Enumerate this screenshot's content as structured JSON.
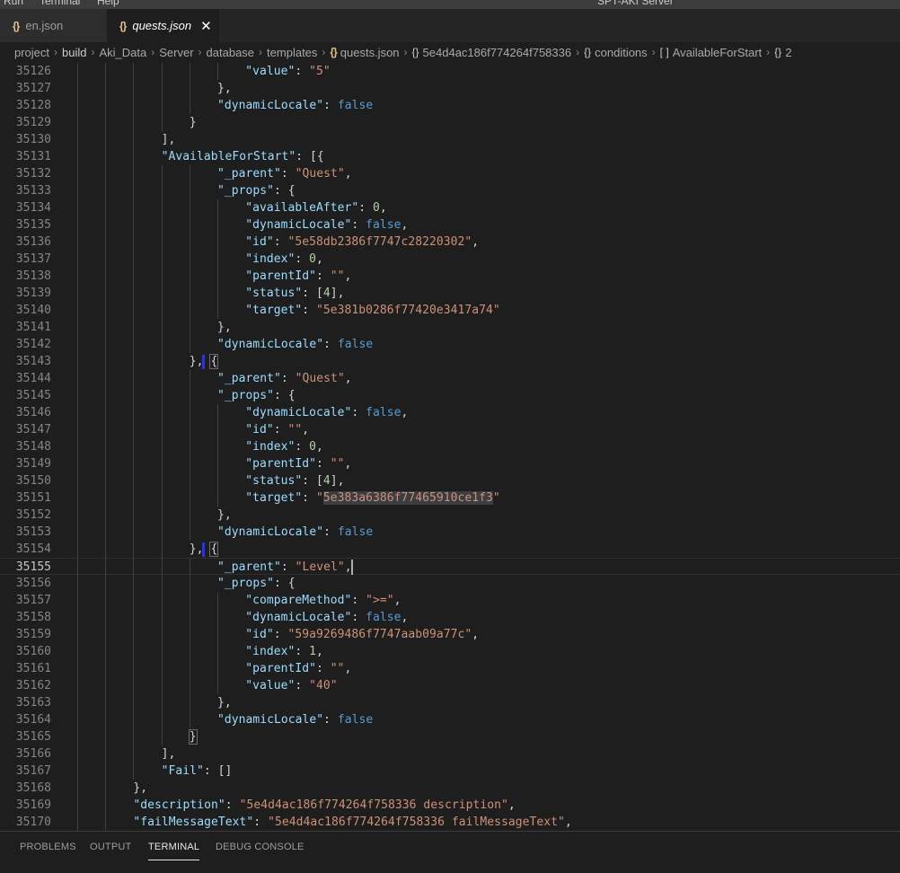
{
  "menubar": {
    "items": [
      "Run",
      "Terminal",
      "Help"
    ],
    "window_title": "SPT-AKI Server"
  },
  "tabs": [
    {
      "label": "en.json",
      "active": false
    },
    {
      "label": "quests.json",
      "active": true
    }
  ],
  "breadcrumb": [
    "project",
    "build",
    "Aki_Data",
    "Server",
    "database",
    "templates",
    "quests.json",
    "5e4d4ac186f774264f758336",
    "conditions",
    "AvailableForStart",
    "2"
  ],
  "editor": {
    "current_line": 35155,
    "lines": [
      {
        "n": 35126,
        "indent": 6,
        "tokens": [
          [
            "k",
            "\"value\""
          ],
          [
            "p",
            ": "
          ],
          [
            "s",
            "\"5\""
          ]
        ]
      },
      {
        "n": 35127,
        "indent": 5,
        "tokens": [
          [
            "p",
            "},"
          ]
        ]
      },
      {
        "n": 35128,
        "indent": 5,
        "tokens": [
          [
            "k",
            "\"dynamicLocale\""
          ],
          [
            "p",
            ": "
          ],
          [
            "b",
            "false"
          ]
        ]
      },
      {
        "n": 35129,
        "indent": 4,
        "tokens": [
          [
            "p",
            "}"
          ]
        ]
      },
      {
        "n": 35130,
        "indent": 3,
        "tokens": [
          [
            "p",
            "],"
          ]
        ]
      },
      {
        "n": 35131,
        "indent": 3,
        "tokens": [
          [
            "k",
            "\"AvailableForStart\""
          ],
          [
            "p",
            ": [{"
          ]
        ]
      },
      {
        "n": 35132,
        "indent": 5,
        "tokens": [
          [
            "k",
            "\"_parent\""
          ],
          [
            "p",
            ": "
          ],
          [
            "s",
            "\"Quest\""
          ],
          [
            "p",
            ","
          ]
        ]
      },
      {
        "n": 35133,
        "indent": 5,
        "tokens": [
          [
            "k",
            "\"_props\""
          ],
          [
            "p",
            ": {"
          ]
        ]
      },
      {
        "n": 35134,
        "indent": 6,
        "tokens": [
          [
            "k",
            "\"availableAfter\""
          ],
          [
            "p",
            ": "
          ],
          [
            "n",
            "0"
          ],
          [
            "p",
            ","
          ]
        ]
      },
      {
        "n": 35135,
        "indent": 6,
        "tokens": [
          [
            "k",
            "\"dynamicLocale\""
          ],
          [
            "p",
            ": "
          ],
          [
            "b",
            "false"
          ],
          [
            "p",
            ","
          ]
        ]
      },
      {
        "n": 35136,
        "indent": 6,
        "tokens": [
          [
            "k",
            "\"id\""
          ],
          [
            "p",
            ": "
          ],
          [
            "s",
            "\"5e58db2386f7747c28220302\""
          ],
          [
            "p",
            ","
          ]
        ]
      },
      {
        "n": 35137,
        "indent": 6,
        "tokens": [
          [
            "k",
            "\"index\""
          ],
          [
            "p",
            ": "
          ],
          [
            "n",
            "0"
          ],
          [
            "p",
            ","
          ]
        ]
      },
      {
        "n": 35138,
        "indent": 6,
        "tokens": [
          [
            "k",
            "\"parentId\""
          ],
          [
            "p",
            ": "
          ],
          [
            "s",
            "\"\""
          ],
          [
            "p",
            ","
          ]
        ]
      },
      {
        "n": 35139,
        "indent": 6,
        "tokens": [
          [
            "k",
            "\"status\""
          ],
          [
            "p",
            ": ["
          ],
          [
            "n",
            "4"
          ],
          [
            "p",
            "],"
          ]
        ]
      },
      {
        "n": 35140,
        "indent": 6,
        "tokens": [
          [
            "k",
            "\"target\""
          ],
          [
            "p",
            ": "
          ],
          [
            "s",
            "\"5e381b0286f77420e3417a74\""
          ]
        ]
      },
      {
        "n": 35141,
        "indent": 5,
        "tokens": [
          [
            "p",
            "},"
          ]
        ]
      },
      {
        "n": 35142,
        "indent": 5,
        "tokens": [
          [
            "k",
            "\"dynamicLocale\""
          ],
          [
            "p",
            ": "
          ],
          [
            "b",
            "false"
          ]
        ]
      },
      {
        "n": 35143,
        "indent": 4,
        "tokens": [
          [
            "p",
            "}, "
          ],
          [
            "brk",
            "{"
          ]
        ],
        "bluebar": true
      },
      {
        "n": 35144,
        "indent": 5,
        "tokens": [
          [
            "k",
            "\"_parent\""
          ],
          [
            "p",
            ": "
          ],
          [
            "s",
            "\"Quest\""
          ],
          [
            "p",
            ","
          ]
        ]
      },
      {
        "n": 35145,
        "indent": 5,
        "tokens": [
          [
            "k",
            "\"_props\""
          ],
          [
            "p",
            ": {"
          ]
        ]
      },
      {
        "n": 35146,
        "indent": 6,
        "tokens": [
          [
            "k",
            "\"dynamicLocale\""
          ],
          [
            "p",
            ": "
          ],
          [
            "b",
            "false"
          ],
          [
            "p",
            ","
          ]
        ]
      },
      {
        "n": 35147,
        "indent": 6,
        "tokens": [
          [
            "k",
            "\"id\""
          ],
          [
            "p",
            ": "
          ],
          [
            "s",
            "\"\""
          ],
          [
            "p",
            ","
          ]
        ]
      },
      {
        "n": 35148,
        "indent": 6,
        "tokens": [
          [
            "k",
            "\"index\""
          ],
          [
            "p",
            ": "
          ],
          [
            "n",
            "0"
          ],
          [
            "p",
            ","
          ]
        ]
      },
      {
        "n": 35149,
        "indent": 6,
        "tokens": [
          [
            "k",
            "\"parentId\""
          ],
          [
            "p",
            ": "
          ],
          [
            "s",
            "\"\""
          ],
          [
            "p",
            ","
          ]
        ]
      },
      {
        "n": 35150,
        "indent": 6,
        "tokens": [
          [
            "k",
            "\"status\""
          ],
          [
            "p",
            ": ["
          ],
          [
            "n",
            "4"
          ],
          [
            "p",
            "],"
          ]
        ]
      },
      {
        "n": 35151,
        "indent": 6,
        "tokens": [
          [
            "k",
            "\"target\""
          ],
          [
            "p",
            ": "
          ],
          [
            "s",
            "\""
          ],
          [
            "hl",
            "5e383a6386f77465910ce1f3"
          ],
          [
            "s",
            "\""
          ]
        ]
      },
      {
        "n": 35152,
        "indent": 5,
        "tokens": [
          [
            "p",
            "},"
          ]
        ]
      },
      {
        "n": 35153,
        "indent": 5,
        "tokens": [
          [
            "k",
            "\"dynamicLocale\""
          ],
          [
            "p",
            ": "
          ],
          [
            "b",
            "false"
          ]
        ]
      },
      {
        "n": 35154,
        "indent": 4,
        "tokens": [
          [
            "p",
            "}, "
          ],
          [
            "brk",
            "{"
          ]
        ],
        "bluebar": true
      },
      {
        "n": 35155,
        "indent": 5,
        "tokens": [
          [
            "k",
            "\"_parent\""
          ],
          [
            "p",
            ": "
          ],
          [
            "s",
            "\"Level\""
          ],
          [
            "p",
            ","
          ]
        ],
        "caret": true
      },
      {
        "n": 35156,
        "indent": 5,
        "tokens": [
          [
            "k",
            "\"_props\""
          ],
          [
            "p",
            ": {"
          ]
        ]
      },
      {
        "n": 35157,
        "indent": 6,
        "tokens": [
          [
            "k",
            "\"compareMethod\""
          ],
          [
            "p",
            ": "
          ],
          [
            "s",
            "\">=\""
          ],
          [
            "p",
            ","
          ]
        ]
      },
      {
        "n": 35158,
        "indent": 6,
        "tokens": [
          [
            "k",
            "\"dynamicLocale\""
          ],
          [
            "p",
            ": "
          ],
          [
            "b",
            "false"
          ],
          [
            "p",
            ","
          ]
        ]
      },
      {
        "n": 35159,
        "indent": 6,
        "tokens": [
          [
            "k",
            "\"id\""
          ],
          [
            "p",
            ": "
          ],
          [
            "s",
            "\"59a9269486f7747aab09a77c\""
          ],
          [
            "p",
            ","
          ]
        ]
      },
      {
        "n": 35160,
        "indent": 6,
        "tokens": [
          [
            "k",
            "\"index\""
          ],
          [
            "p",
            ": "
          ],
          [
            "n",
            "1"
          ],
          [
            "p",
            ","
          ]
        ]
      },
      {
        "n": 35161,
        "indent": 6,
        "tokens": [
          [
            "k",
            "\"parentId\""
          ],
          [
            "p",
            ": "
          ],
          [
            "s",
            "\"\""
          ],
          [
            "p",
            ","
          ]
        ]
      },
      {
        "n": 35162,
        "indent": 6,
        "tokens": [
          [
            "k",
            "\"value\""
          ],
          [
            "p",
            ": "
          ],
          [
            "s",
            "\"40\""
          ]
        ]
      },
      {
        "n": 35163,
        "indent": 5,
        "tokens": [
          [
            "p",
            "},"
          ]
        ]
      },
      {
        "n": 35164,
        "indent": 5,
        "tokens": [
          [
            "k",
            "\"dynamicLocale\""
          ],
          [
            "p",
            ": "
          ],
          [
            "b",
            "false"
          ]
        ]
      },
      {
        "n": 35165,
        "indent": 4,
        "tokens": [
          [
            "brk",
            "}"
          ]
        ]
      },
      {
        "n": 35166,
        "indent": 3,
        "tokens": [
          [
            "p",
            "],"
          ]
        ]
      },
      {
        "n": 35167,
        "indent": 3,
        "tokens": [
          [
            "k",
            "\"Fail\""
          ],
          [
            "p",
            ": []"
          ]
        ]
      },
      {
        "n": 35168,
        "indent": 2,
        "tokens": [
          [
            "p",
            "},"
          ]
        ]
      },
      {
        "n": 35169,
        "indent": 2,
        "tokens": [
          [
            "k",
            "\"description\""
          ],
          [
            "p",
            ": "
          ],
          [
            "s",
            "\"5e4d4ac186f774264f758336 description\""
          ],
          [
            "p",
            ","
          ]
        ]
      },
      {
        "n": 35170,
        "indent": 2,
        "tokens": [
          [
            "k",
            "\"failMessageText\""
          ],
          [
            "p",
            ": "
          ],
          [
            "s",
            "\"5e4d4ac186f774264f758336 failMessageText\""
          ],
          [
            "p",
            ","
          ]
        ]
      }
    ]
  },
  "panel": {
    "tabs": [
      {
        "label": "PROBLEMS",
        "active": false
      },
      {
        "label": "OUTPUT",
        "active": false
      },
      {
        "label": "TERMINAL",
        "active": true
      },
      {
        "label": "DEBUG CONSOLE",
        "active": false
      }
    ]
  }
}
